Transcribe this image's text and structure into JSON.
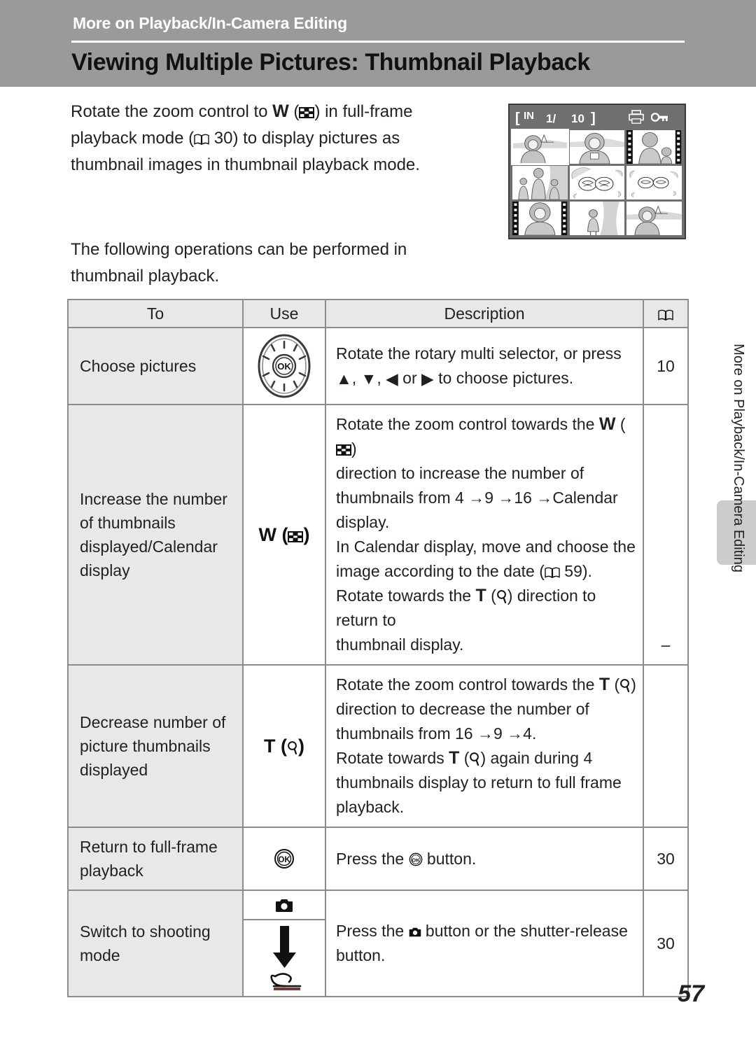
{
  "header": {
    "chapter_label": "More on Playback/In-Camera Editing",
    "page_title": "Viewing Multiple Pictures: Thumbnail Playback",
    "band_color": "#9a9a9a"
  },
  "body": {
    "intro_1a": "Rotate the zoom control to ",
    "intro_w": "W",
    "intro_1b": ") in full-frame playback mode (",
    "intro_page_ref": "30",
    "intro_1c": ") to display pictures as thumbnail images in thumbnail playback mode.",
    "intro_2": "The following operations can be performed in thumbnail playback."
  },
  "camera_screen": {
    "bracket_open": "[",
    "memory_label": "IN",
    "frame_current": "1/",
    "frame_total": "10",
    "bracket_close": "]",
    "print_icon": "print-order-icon",
    "protect_icon": "key-protect-icon",
    "selected_cell_index": 0,
    "thumbnails": [
      "woman-beach-boat",
      "woman-portrait-lake",
      "woman-and-child-film",
      "family-three-rocks",
      "flowers-cabbage",
      "flowers-cabbage-small",
      "woman-portrait-film",
      "child-standing-rocks",
      "woman-beach-boat"
    ]
  },
  "table": {
    "headers": {
      "to": "To",
      "use": "Use",
      "description": "Description",
      "page": "book-icon"
    },
    "rows": [
      {
        "to": "Choose pictures",
        "use_icon": "rotary-multi-selector-icon",
        "use_label": "",
        "description_parts": [
          "Rotate the rotary multi selector, or press ",
          "▲",
          ", ",
          "▼",
          ", ",
          "◀",
          " or ",
          "▶",
          " to choose pictures."
        ],
        "description_plain": "Rotate the rotary multi selector, or press ▲, ▼, ◀ or ▶ to choose pictures.",
        "page": "10"
      },
      {
        "to": "Increase the number of thumbnails displayed/Calendar display",
        "use_icon": "zoom-wide-thumbnail-icon",
        "use_label": "W",
        "description_plain": "Rotate the zoom control towards the W (thumbnail) direction to increase the number of thumbnails from 4 → 9 →16 → Calendar display. In Calendar display, move and choose the image according to the date (59). Rotate towards the T (magnify) direction to return to thumbnail display.",
        "d_l1a": "Rotate the zoom control towards the ",
        "d_l1b": "W",
        "d_l1c": ")",
        "d_l2": "direction to increase the number of",
        "d_l3a": "thumbnails from 4 ",
        "d_l3b": "9 ",
        "d_l3c": "16 ",
        "d_l3d": "Calendar",
        "d_l4": "display.",
        "d_l5": "In Calendar display, move and choose the",
        "d_l6a": "image according to the date (",
        "d_l6b": "59).",
        "d_l7a": "Rotate towards the ",
        "d_l7b": "T",
        "d_l7c": ") direction to return to",
        "d_l8": "thumbnail display.",
        "page": "–"
      },
      {
        "to": "Decrease number of picture thumbnails displayed",
        "use_icon": "zoom-tele-magnify-icon",
        "use_label": "T",
        "description_plain": "Rotate the zoom control towards the T (magnify) direction to decrease the number of thumbnails from 16 → 9 → 4. Rotate towards T (magnify) again during 4 thumbnails display to return to full frame playback.",
        "d_l1a": "Rotate the zoom control towards the ",
        "d_l1b": "T",
        "d_l1c": ")",
        "d_l2": "direction to decrease the number of",
        "d_l3a": "thumbnails from 16 ",
        "d_l3b": "9 ",
        "d_l3c": "4.",
        "d_l4a": "Rotate towards ",
        "d_l4b": "T",
        "d_l4c": ") again during 4",
        "d_l5": "thumbnails display to return to full frame",
        "d_l6": "playback.",
        "page": ""
      },
      {
        "to": "Return to full-frame playback",
        "use_icon": "ok-button-icon",
        "use_label": "",
        "description_plain": "Press the OK button.",
        "d_a": "Press the ",
        "d_b": " button.",
        "page": "30"
      },
      {
        "to": "Switch to shooting mode",
        "use_icon": "camera-mode-button-icon",
        "use_icon_2": "shutter-release-arrow-icon",
        "use_label": "",
        "description_plain": "Press the camera button or the shutter-release button.",
        "d_a": "Press the ",
        "d_b": " button or the shutter-release",
        "d_c": "button.",
        "page": "30"
      }
    ]
  },
  "side_tab": {
    "label": "More on Playback/In-Camera Editing",
    "bar_color": "#cccccc"
  },
  "folio": {
    "page_number": "57"
  }
}
